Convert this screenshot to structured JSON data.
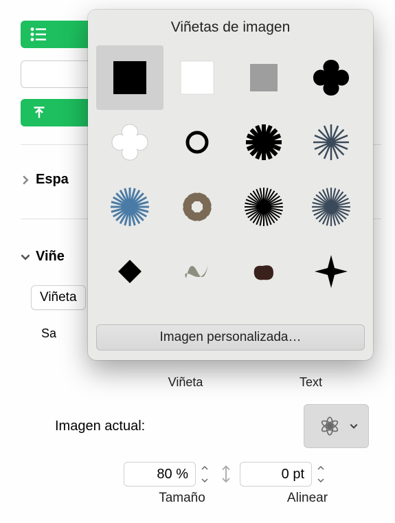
{
  "sidebar": {
    "espaciado_label": "Espa",
    "vinetas_label": "Viñe",
    "vineta_type": "Viñeta",
    "sangria_prefix": "Sa"
  },
  "labels_row": {
    "vineta": "Viñeta",
    "texto": "Text"
  },
  "current_image": {
    "label": "Imagen actual:",
    "icon": "flower-outline-icon"
  },
  "size": {
    "value": "80 %",
    "label": "Tamaño"
  },
  "align": {
    "value": "0 pt",
    "label": "Alinear"
  },
  "popover": {
    "title": "Viñetas de imagen",
    "custom_button": "Imagen personalizada…",
    "bullets": [
      {
        "id": "black-square",
        "selected": true
      },
      {
        "id": "white-square"
      },
      {
        "id": "gray-square"
      },
      {
        "id": "quatrefoil-black"
      },
      {
        "id": "quatrefoil-white"
      },
      {
        "id": "ring-black"
      },
      {
        "id": "starburst-black"
      },
      {
        "id": "starburst-white-outline"
      },
      {
        "id": "sunburst-blue"
      },
      {
        "id": "asterisk-brown"
      },
      {
        "id": "rays-black"
      },
      {
        "id": "rays-navy"
      },
      {
        "id": "diamond-black"
      },
      {
        "id": "scribble-gray"
      },
      {
        "id": "blob-darkred"
      },
      {
        "id": "sparkle-black"
      },
      {
        "id": "diamond-small"
      }
    ]
  }
}
